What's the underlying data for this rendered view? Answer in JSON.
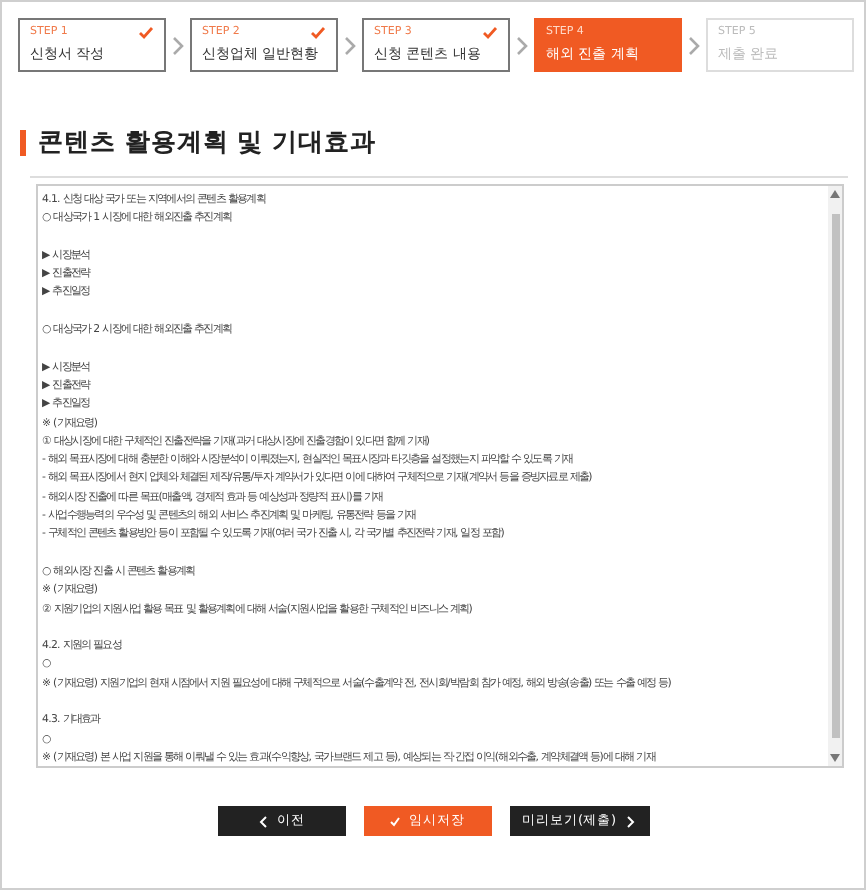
{
  "steps": [
    {
      "step": "STEP 1",
      "label": "신청서 작성",
      "done": true,
      "selected": false
    },
    {
      "step": "STEP 2",
      "label": "신청업체 일반현황",
      "done": true,
      "selected": false
    },
    {
      "step": "STEP 3",
      "label": "신청 콘텐츠 내용",
      "done": true,
      "selected": false
    },
    {
      "step": "STEP 4",
      "label": "해외 진출 계획",
      "done": false,
      "selected": true
    },
    {
      "step": "STEP 5",
      "label": "제출 완료",
      "done": false,
      "selected": false
    }
  ],
  "section_title": "콘텐츠 활용계획 및 기대효과",
  "editor": {
    "blocks": [
      [
        "4.1. 신청 대상 국가 또는 지역에서의 콘텐츠 활용계획",
        "○ 대상국가 1 시장에 대한 해외진출 추진계획"
      ],
      [
        "▶ 시장분석",
        "▶ 진출전략",
        "▶ 추진일정"
      ],
      [
        "○ 대상국가 2 시장에 대한 해외진출 추진계획"
      ],
      [
        "▶ 시장분석",
        "▶ 진출전략",
        "▶ 추진일정",
        "※ (기재요령)",
        "① 대상시장에 대한 구체적인 진출전략을 기재(과거 대상시장에 진출경험이 있다면 함께 기재)",
        "- 해외 목표시장에 대해 충분한 이해와 시장분석이 이뤄졌는지, 현실적인 목표시장과 타깃층을 설정했는지 파악할 수 있도록 기재",
        "- 해외 목표시장에서 현지 업체와 체결된 제작/유통/투자 계약서가 있다면 이에 대하여 구체적으로 기재(계약서 등을 증빙자료로 제출)",
        "- 해외시장 진출에 따른 목표(매출액, 경제적 효과 등 예상성과 정량적 표시)를 기재",
        "- 사업수행능력의 우수성 및 콘텐츠의 해외 서비스 추진계획 및 마케팅, 유통전략 등을 기재",
        "- 구체적인 콘텐츠 활용방안 등이 포함될 수 있도록 기재(여러 국가 진출 시, 각 국가별 추진전략 기재, 일정 포함)"
      ],
      [
        "○ 해외시장 진출 시 콘텐츠 활용계획",
        "※ (기재요령)",
        "② 지원기업의 지원사업 활용 목표 및 활용계획에 대해 서술(지원사업을 활용한 구체적인 비즈니스 계획)"
      ],
      [
        "4.2. 지원의 필요성",
        "○",
        "※ (기재요령) 지원기업의 현재 시점에서 지원 필요성에 대해 구체적으로 서술(수출계약 전, 전시회/박람회 참가 예정, 해외 방송(송출) 또는 수출 예정 등)"
      ],
      [
        "4.3. 기대효과",
        "○",
        "※ (기재요령) 본 사업 지원을 통해 이뤄낼 수 있는 효과(수익향상, 국가브랜드 제고 등), 예상되는 직·간접 이익(해외수출, 계약체결액 등)에 대해 기재"
      ]
    ]
  },
  "buttons": [
    {
      "label": "이전",
      "kind": "prev"
    },
    {
      "label": "임시저장",
      "kind": "save"
    },
    {
      "label": "미리보기(제출)",
      "kind": "next"
    }
  ]
}
